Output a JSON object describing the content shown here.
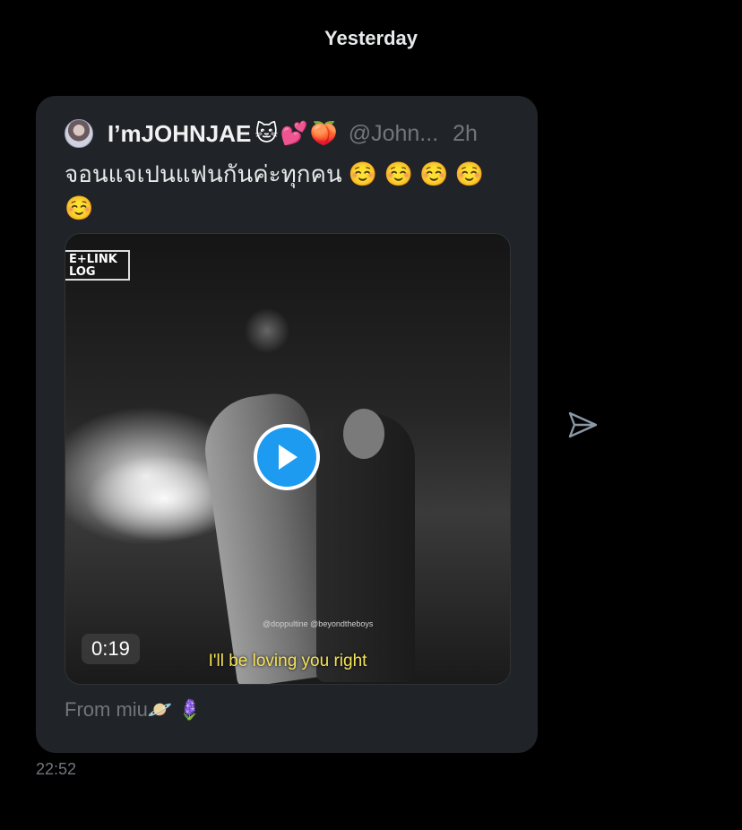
{
  "date_separator": "Yesterday",
  "tweet": {
    "display_name": "I’mJOHNJAE",
    "name_emojis": "🐱💕🍑",
    "handle": "@John...",
    "time": "2h",
    "text": "จอนแจเปนแฟนกันค่ะทุกคน ☺️ ☺️ ☺️ ☺️ ☺️",
    "media": {
      "type": "video",
      "duration": "0:19",
      "subtitle": "I'll be loving you right",
      "logo": "E+LINK LOG",
      "watermark": "@doppultine @beyondtheboys"
    }
  },
  "message_text": "From miu🪐 🪻",
  "message_time": "22:52",
  "icons": {
    "play": "play-icon",
    "share": "send-icon"
  },
  "colors": {
    "accent": "#1d9bf0",
    "card_bg": "#202327",
    "muted": "#71767b"
  }
}
